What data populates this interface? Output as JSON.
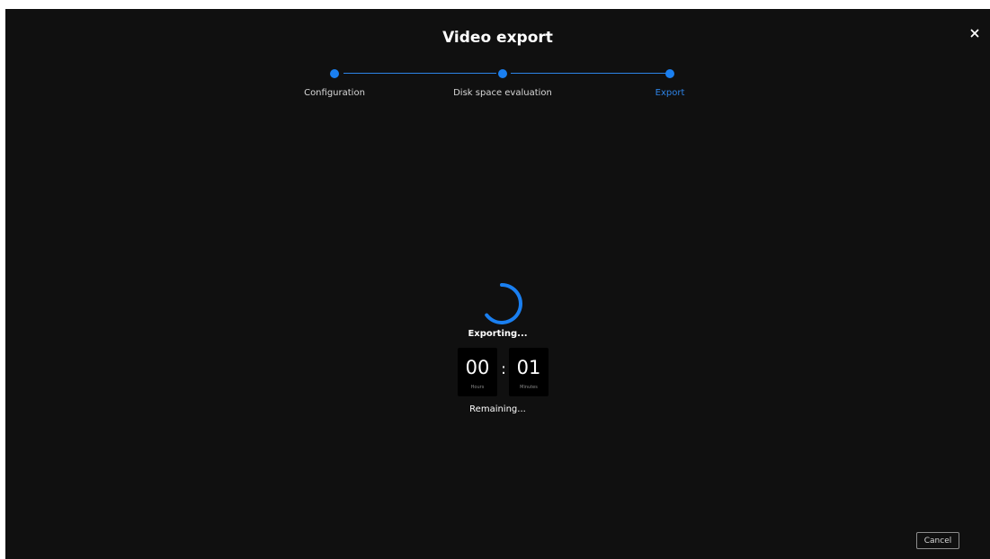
{
  "dialog": {
    "title": "Video export",
    "close_icon": "close-icon",
    "accent_color": "#1a7ff0",
    "background_color": "#101010"
  },
  "stepper": {
    "steps": [
      {
        "label": "Configuration",
        "state": "completed"
      },
      {
        "label": "Disk space evaluation",
        "state": "completed"
      },
      {
        "label": "Export",
        "state": "active"
      }
    ]
  },
  "progress": {
    "spinner_icon": "loading-spinner-icon",
    "status": "Exporting...",
    "remaining_label": "Remaining..."
  },
  "timer": {
    "hours": "00",
    "hours_label": "Hours",
    "separator": ":",
    "minutes": "01",
    "minutes_label": "Minutes"
  },
  "footer": {
    "cancel_label": "Cancel"
  }
}
